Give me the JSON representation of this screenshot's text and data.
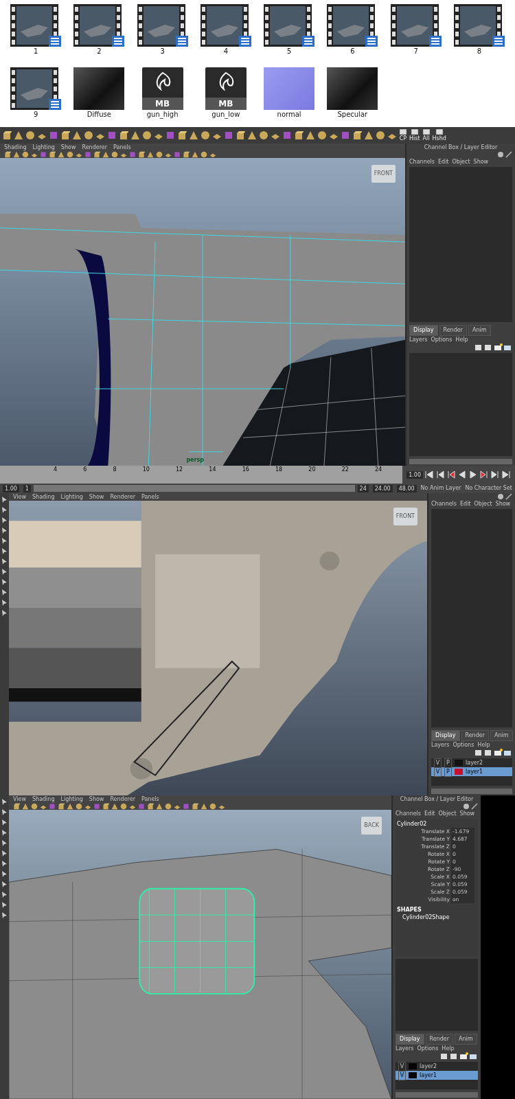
{
  "file_browser": {
    "items": [
      {
        "kind": "video",
        "label": "1"
      },
      {
        "kind": "video",
        "label": "2"
      },
      {
        "kind": "video",
        "label": "3"
      },
      {
        "kind": "video",
        "label": "4"
      },
      {
        "kind": "video",
        "label": "5"
      },
      {
        "kind": "video",
        "label": "6"
      },
      {
        "kind": "video",
        "label": "7"
      },
      {
        "kind": "video",
        "label": "8"
      },
      {
        "kind": "video",
        "label": "9"
      },
      {
        "kind": "image",
        "label": "Diffuse"
      },
      {
        "kind": "document",
        "label": "gun_high",
        "badge": "MB"
      },
      {
        "kind": "document",
        "label": "gun_low",
        "badge": "MB"
      },
      {
        "kind": "image",
        "label": "normal"
      },
      {
        "kind": "image",
        "label": "Specular"
      }
    ]
  },
  "panels": [
    {
      "shelf": {
        "labels": [
          "CP",
          "Hist",
          "All",
          "Hshd"
        ]
      },
      "viewport": {
        "kind": "wire",
        "menus": [
          "Shading",
          "Lighting",
          "Show",
          "Renderer",
          "Panels"
        ],
        "view_label": "FRONT",
        "camera_label": "persp"
      },
      "channel_box": {
        "title": "Channel Box / Layer Editor",
        "menus": [
          "Channels",
          "Edit",
          "Object",
          "Show"
        ]
      },
      "layer_editor": {
        "tabs": [
          {
            "label": "Display",
            "selected": true
          },
          {
            "label": "Render",
            "selected": false
          },
          {
            "label": "Anim",
            "selected": false
          }
        ],
        "menus": [
          "Layers",
          "Options",
          "Help"
        ]
      },
      "timeline": {
        "ticks": [
          "4",
          "6",
          "8",
          "10",
          "12",
          "14",
          "16",
          "18",
          "20",
          "22",
          "24"
        ],
        "current_frame": "1.00"
      },
      "range": {
        "start": "1.00",
        "slider_start": "1",
        "slider_end": "24",
        "end": "24.00",
        "total_end": "48.00",
        "anim_layer": "No Anim Layer",
        "character_set": "No Character Set"
      }
    },
    {
      "viewport": {
        "kind": "solid",
        "menus": [
          "View",
          "Shading",
          "Lighting",
          "Show",
          "Renderer",
          "Panels"
        ],
        "view_label": "FRONT"
      },
      "channel_box": {
        "menus": [
          "Channels",
          "Edit",
          "Object",
          "Show"
        ]
      },
      "layer_editor": {
        "tabs": [
          {
            "label": "Display",
            "selected": true
          },
          {
            "label": "Render",
            "selected": false
          },
          {
            "label": "Anim",
            "selected": false
          }
        ],
        "menus": [
          "Layers",
          "Options",
          "Help"
        ],
        "layers": [
          {
            "name": "layer2",
            "toggles": [
              "V",
              "P"
            ],
            "color": "#111111",
            "selected": false
          },
          {
            "name": "layer1",
            "toggles": [
              "V",
              "P"
            ],
            "color": "#c8102e",
            "selected": true
          }
        ]
      }
    },
    {
      "viewport": {
        "kind": "cylinder",
        "menus": [
          "View",
          "Shading",
          "Lighting",
          "Show",
          "Renderer",
          "Panels"
        ],
        "view_label": "BACK"
      },
      "channel_box": {
        "title": "Channel Box / Layer Editor",
        "menus": [
          "Channels",
          "Edit",
          "Object",
          "Show"
        ],
        "object": "Cylinder02",
        "attributes": [
          {
            "label": "Translate X",
            "value": "-1.679"
          },
          {
            "label": "Translate Y",
            "value": "4.687"
          },
          {
            "label": "Translate Z",
            "value": "0"
          },
          {
            "label": "Rotate X",
            "value": "0"
          },
          {
            "label": "Rotate Y",
            "value": "0"
          },
          {
            "label": "Rotate Z",
            "value": "-90"
          },
          {
            "label": "Scale X",
            "value": "0.059"
          },
          {
            "label": "Scale Y",
            "value": "0.059"
          },
          {
            "label": "Scale Z",
            "value": "0.059"
          },
          {
            "label": "Visibility",
            "value": "on"
          }
        ],
        "shapes_heading": "SHAPES",
        "shape": "Cylinder02Shape"
      },
      "layer_editor": {
        "tabs": [
          {
            "label": "Display",
            "selected": true
          },
          {
            "label": "Render",
            "selected": false
          },
          {
            "label": "Anim",
            "selected": false
          }
        ],
        "menus": [
          "Layers",
          "Options",
          "Help"
        ],
        "layers": [
          {
            "name": "layer2",
            "toggles": [
              "V"
            ],
            "color": "#000000",
            "selected": false
          },
          {
            "name": "layer1",
            "toggles": [
              "V"
            ],
            "color": "#000000",
            "selected": true
          }
        ]
      }
    }
  ]
}
